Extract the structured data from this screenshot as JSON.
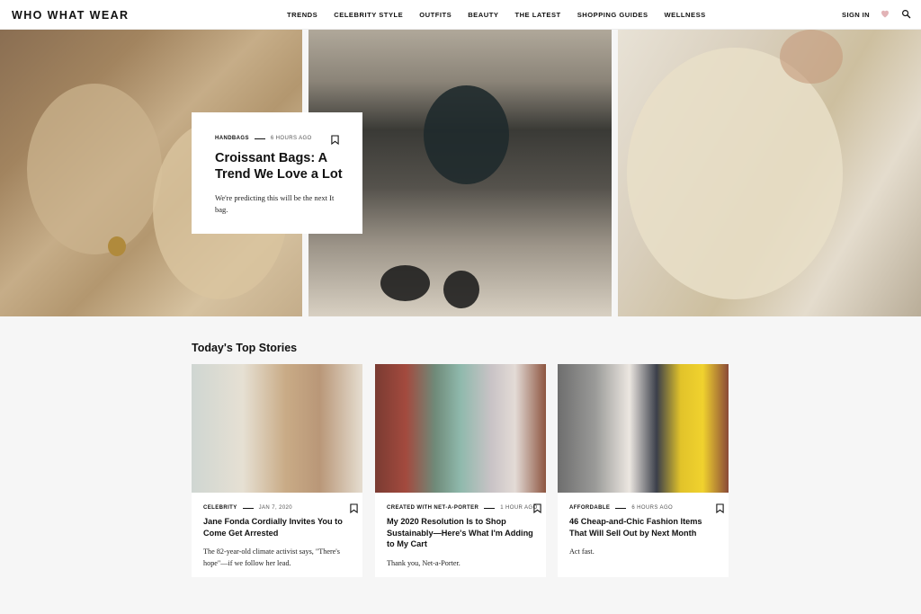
{
  "header": {
    "logo": "WHO WHAT WEAR",
    "menu": [
      "TRENDS",
      "CELEBRITY STYLE",
      "OUTFITS",
      "BEAUTY",
      "THE LATEST",
      "SHOPPING GUIDES",
      "WELLNESS"
    ],
    "sign_in": "SIGN IN"
  },
  "featured": {
    "category": "HANDBAGS",
    "time": "6 HOURS AGO",
    "title": "Croissant Bags: A Trend We Love a Lot",
    "description": "We're predicting this will be the next It bag."
  },
  "top_stories": {
    "heading": "Today's Top Stories",
    "items": [
      {
        "category": "CELEBRITY",
        "time": "JAN 7, 2020",
        "title": "Jane Fonda Cordially Invites You to Come Get Arrested",
        "description": "The 82-year-old climate activist says, \"There's hope\"—if we follow her lead."
      },
      {
        "category": "CREATED WITH NET-A-PORTER",
        "time": "1 HOUR AGO",
        "title": "My 2020 Resolution Is to Shop Sustainably—Here's What I'm Adding to My Cart",
        "description": "Thank you, Net-a-Porter."
      },
      {
        "category": "AFFORDABLE",
        "time": "6 HOURS AGO",
        "title": "46 Cheap-and-Chic Fashion Items That Will Sell Out by Next Month",
        "description": "Act fast."
      }
    ]
  },
  "icons": {
    "heart": "heart-icon",
    "search": "search-icon",
    "bookmark": "bookmark-icon"
  },
  "colors": {
    "heart": "#e2b3b6",
    "background": "#f6f6f6"
  }
}
